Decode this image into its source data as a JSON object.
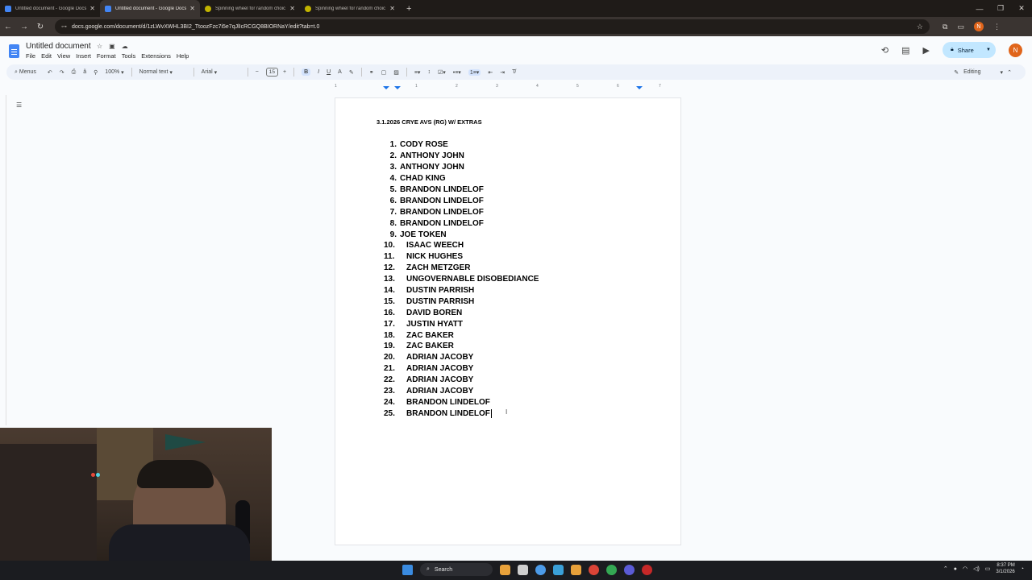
{
  "browser": {
    "tabs": [
      {
        "label": "Untitled document - Google Docs",
        "icon": "docs-icon",
        "active": false
      },
      {
        "label": "Untitled document - Google Docs",
        "icon": "docs-icon",
        "active": true
      },
      {
        "label": "Spinning wheel for random choic",
        "icon": "wheel-icon",
        "active": false
      },
      {
        "label": "Spinning wheel for random choic",
        "icon": "wheel-icon",
        "active": false
      }
    ],
    "new_tab": "+",
    "url": "docs.google.com/document/d/1zLWvXWHL3BI2_TtoozFzc7i5e7qJlIcRCGQ8BIORNaY/edit?tab=t.0",
    "profile_initial": "N"
  },
  "docs": {
    "title": "Untitled document",
    "menu": [
      "File",
      "Edit",
      "View",
      "Insert",
      "Format",
      "Tools",
      "Extensions",
      "Help"
    ],
    "share_label": "Share",
    "avatar_initial": "N",
    "accent": "#c2e7ff"
  },
  "toolbar": {
    "search_menus": "Menus",
    "zoom": "100%",
    "style": "Normal text",
    "font": "Arial",
    "font_size": "15",
    "mode": "Editing"
  },
  "ruler": [
    "1",
    "1",
    "2",
    "3",
    "4",
    "5",
    "6",
    "7"
  ],
  "document": {
    "heading": "3.1.2026 CRYE AVS (RG) W/ EXTRAS",
    "items": [
      {
        "n": "1.",
        "name": "CODY ROSE"
      },
      {
        "n": "2.",
        "name": "ANTHONY JOHN"
      },
      {
        "n": "3.",
        "name": "ANTHONY JOHN"
      },
      {
        "n": "4.",
        "name": "CHAD KING"
      },
      {
        "n": "5.",
        "name": "BRANDON LINDELOF"
      },
      {
        "n": "6.",
        "name": "BRANDON LINDELOF"
      },
      {
        "n": "7.",
        "name": "BRANDON LINDELOF"
      },
      {
        "n": "8.",
        "name": "BRANDON LINDELOF"
      },
      {
        "n": "9.",
        "name": "JOE TOKEN"
      },
      {
        "n": "10.",
        "name": "ISAAC WEECH"
      },
      {
        "n": "11.",
        "name": "NICK HUGHES"
      },
      {
        "n": "12.",
        "name": "ZACH METZGER"
      },
      {
        "n": "13.",
        "name": "UNGOVERNABLE DISOBEDIANCE"
      },
      {
        "n": "14.",
        "name": "DUSTIN PARRISH"
      },
      {
        "n": "15.",
        "name": "DUSTIN PARRISH"
      },
      {
        "n": "16.",
        "name": "DAVID BOREN"
      },
      {
        "n": "17.",
        "name": "JUSTIN HYATT"
      },
      {
        "n": "18.",
        "name": "ZAC BAKER"
      },
      {
        "n": "19.",
        "name": "ZAC BAKER"
      },
      {
        "n": "20.",
        "name": "ADRIAN JACOBY"
      },
      {
        "n": "21.",
        "name": "ADRIAN JACOBY"
      },
      {
        "n": "22.",
        "name": "ADRIAN JACOBY"
      },
      {
        "n": "23.",
        "name": "ADRIAN JACOBY"
      },
      {
        "n": "24.",
        "name": "BRANDON LINDELOF"
      },
      {
        "n": "25.",
        "name": "BRANDON LINDELOF"
      }
    ]
  },
  "taskbar": {
    "search_label": "Search",
    "time": "8:37 PM",
    "date": "3/1/2026"
  }
}
